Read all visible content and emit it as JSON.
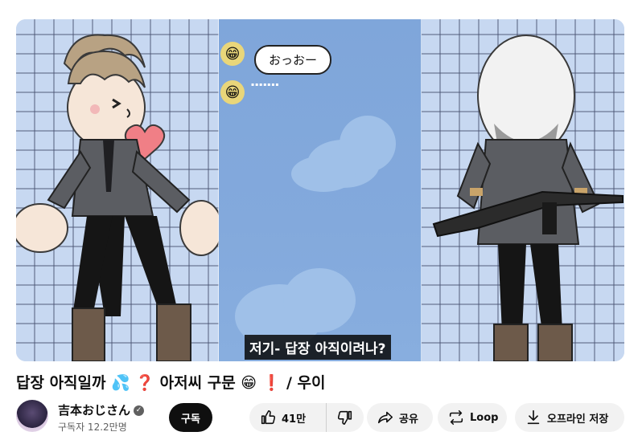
{
  "video": {
    "bubble_text": "おっおー",
    "caption": "저기- 답장 아직이려나?"
  },
  "title": "답장 아직일까 💦 ❓ 아저씨 구문 😁 ❗ / 우이",
  "channel": {
    "name": "吉本おじさん",
    "subscribers": "구독자 12.2만명",
    "subscribe_label": "구독"
  },
  "actions": {
    "like_count": "41만",
    "share_label": "공유",
    "loop_label": "Loop",
    "save_label": "오프라인 저장"
  },
  "icons": {
    "like": "thumbs-up-icon",
    "dislike": "thumbs-down-icon",
    "share": "share-arrow-icon",
    "loop": "loop-icon",
    "save": "download-icon",
    "verified": "verified-check-icon"
  }
}
